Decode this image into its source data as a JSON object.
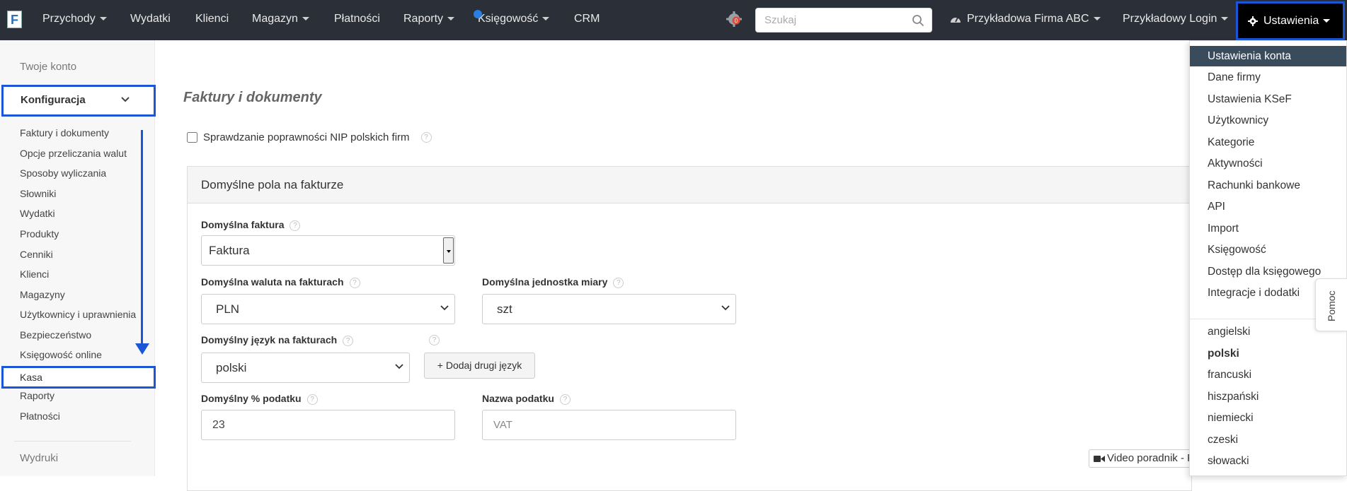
{
  "navbar": {
    "logo": "F",
    "items": [
      {
        "label": "Przychody",
        "dropdown": true
      },
      {
        "label": "Wydatki",
        "dropdown": false
      },
      {
        "label": "Klienci",
        "dropdown": false
      },
      {
        "label": "Magazyn",
        "dropdown": true
      },
      {
        "label": "Płatności",
        "dropdown": false
      },
      {
        "label": "Raporty",
        "dropdown": true
      },
      {
        "label": "Księgowość",
        "dropdown": true
      },
      {
        "label": "CRM",
        "dropdown": false
      }
    ],
    "notification_badge": "0",
    "search_placeholder": "Szukaj",
    "company": "Przykładowa Firma ABC",
    "login": "Przykładowy Login",
    "settings": "Ustawienia"
  },
  "sidebar": {
    "account": "Twoje konto",
    "config": "Konfiguracja",
    "links": [
      "Faktury i dokumenty",
      "Opcje przeliczania walut",
      "Sposoby wyliczania",
      "Słowniki",
      "Wydatki",
      "Produkty",
      "Cenniki",
      "Klienci",
      "Magazyny",
      "Użytkownicy i uprawnienia",
      "Bezpieczeństwo",
      "Księgowość online"
    ],
    "kasa": "Kasa",
    "links_after": [
      "Raporty",
      "Płatności"
    ],
    "prints": "Wydruki"
  },
  "main": {
    "title": "Faktury i dokumenty",
    "nip_check_label": "Sprawdzanie poprawności NIP polskich firm",
    "nip_check_checked": false,
    "panel_title": "Domyślne pola na fakturze",
    "default_invoice": {
      "label": "Domyślna faktura",
      "value": "Faktura"
    },
    "default_currency": {
      "label": "Domyślna waluta na fakturach",
      "value": "PLN"
    },
    "default_unit": {
      "label": "Domyślna jednostka miary",
      "value": "szt"
    },
    "default_language": {
      "label": "Domyślny język na fakturach",
      "value": "polski"
    },
    "add_language": "+ Dodaj drugi język",
    "default_tax": {
      "label": "Domyślny % podatku",
      "value": "23"
    },
    "tax_name": {
      "label": "Nazwa podatku",
      "placeholder": "VAT"
    },
    "video_guide": "Video poradnik - P",
    "help_glyph": "?"
  },
  "dropdown": {
    "items": [
      "Ustawienia konta",
      "Dane firmy",
      "Ustawienia KSeF",
      "Użytkownicy",
      "Kategorie",
      "Aktywności",
      "Rachunki bankowe",
      "API",
      "Import",
      "Księgowość",
      "Dostęp dla księgowego",
      "Integracje i dodatki"
    ],
    "active_item": "Ustawienia konta",
    "languages": [
      "angielski",
      "polski",
      "francuski",
      "hiszpański",
      "niemiecki",
      "czeski",
      "słowacki"
    ],
    "active_language": "polski"
  },
  "help_tab": "Pomoc",
  "colors": {
    "navbar_bg": "#2b3038",
    "highlight_border": "#1a56d6",
    "dropdown_active_bg": "#3a4b5c",
    "sidebar_bg": "#f7f7f7"
  }
}
